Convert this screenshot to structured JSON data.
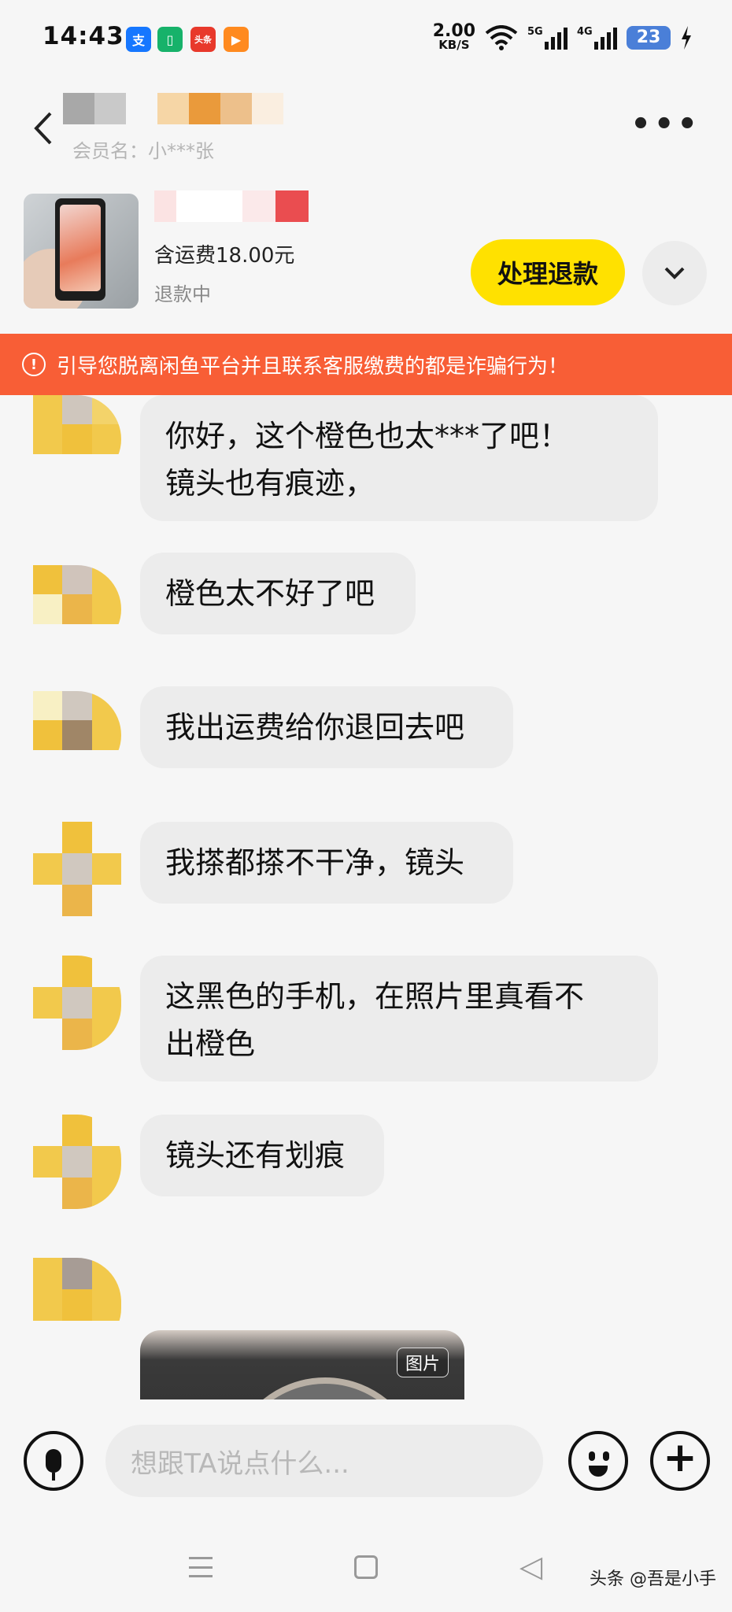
{
  "status_bar": {
    "time": "14:43",
    "net_speed_value": "2.00",
    "net_speed_unit": "KB/S",
    "signal_1_label": "5G",
    "signal_2_label": "4G",
    "battery": "23",
    "icons": [
      "alipay-icon",
      "wallet-icon",
      "toutiao-icon",
      "video-app-icon",
      "wifi-icon",
      "signal-icon",
      "charging-icon"
    ]
  },
  "header": {
    "member_label": "会员名：小***张",
    "back_icon": "chevron-left-icon",
    "more_icon": "more-dots-icon"
  },
  "product": {
    "price": "含运费18.00元",
    "status": "退款中",
    "refund_button": "处理退款",
    "expand_icon": "chevron-down-icon"
  },
  "warning": {
    "text": "引导您脱离闲鱼平台并且联系客服缴费的都是诈骗行为！"
  },
  "messages": [
    {
      "text": "你好，这个橙色也太***了吧！\n镜头也有痕迹，"
    },
    {
      "text": "橙色太不好了吧"
    },
    {
      "text": "我出运费给你退回去吧"
    },
    {
      "text": "我搽都搽不干净，镜头"
    },
    {
      "text": "这黑色的手机，在照片里真看不\n出橙色"
    },
    {
      "text": "镜头还有划痕"
    },
    {
      "image_tag": "图片"
    }
  ],
  "input": {
    "placeholder": "想跟TA说点什么..."
  },
  "watermark": "头条 @吾是小手",
  "colors": {
    "accent_yellow": "#ffe100",
    "warning_bg": "#f85e36",
    "bubble_bg": "#ececec"
  }
}
